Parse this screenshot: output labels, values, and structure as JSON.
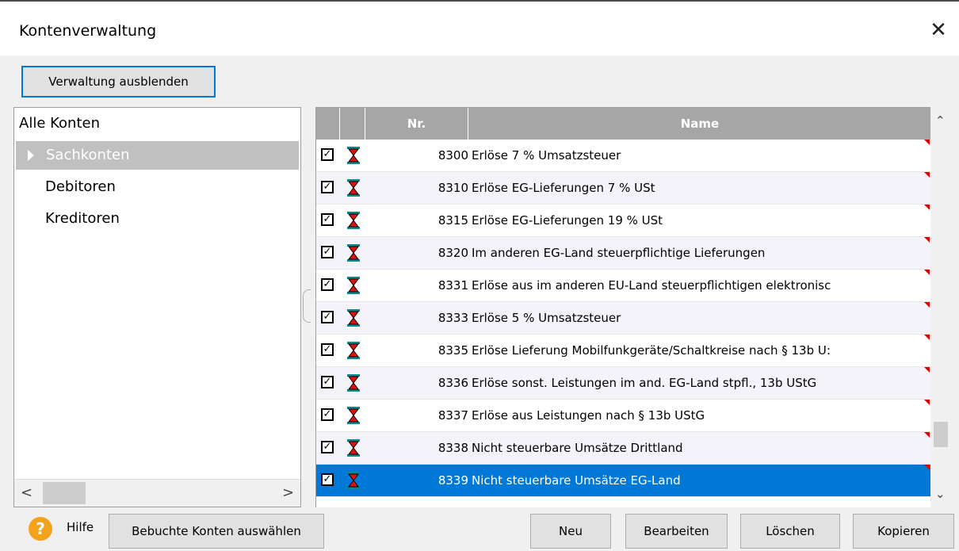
{
  "window": {
    "title": "Kontenverwaltung"
  },
  "toolbar": {
    "toggle_label": "Verwaltung ausblenden"
  },
  "tree": {
    "items": [
      {
        "label": "Alle Konten"
      },
      {
        "label": "Sachkonten"
      },
      {
        "label": "Debitoren"
      },
      {
        "label": "Kreditoren"
      }
    ],
    "selected": "Sachkonten"
  },
  "grid": {
    "headers": {
      "nr": "Nr.",
      "name": "Name"
    },
    "rows": [
      {
        "nr": "8300",
        "name": "Erlöse 7 % Umsatzsteuer",
        "checked": true
      },
      {
        "nr": "8310",
        "name": "Erlöse EG-Lieferungen 7 % USt",
        "checked": true
      },
      {
        "nr": "8315",
        "name": "Erlöse EG-Lieferungen 19 % USt",
        "checked": true
      },
      {
        "nr": "8320",
        "name": "Im anderen EG-Land steuerpflichtige Lieferungen",
        "checked": true
      },
      {
        "nr": "8331",
        "name": "Erlöse aus im anderen EU-Land steuerpflichtigen elektronisc",
        "checked": true
      },
      {
        "nr": "8333",
        "name": "Erlöse 5 % Umsatzsteuer",
        "checked": true
      },
      {
        "nr": "8335",
        "name": "Erlöse Lieferung Mobilfunkgeräte/Schaltkreise nach § 13b U:",
        "checked": true
      },
      {
        "nr": "8336",
        "name": "Erlöse sonst. Leistungen im and. EG-Land stpfl., 13b UStG",
        "checked": true
      },
      {
        "nr": "8337",
        "name": "Erlöse aus Leistungen nach § 13b UStG",
        "checked": true
      },
      {
        "nr": "8338",
        "name": "Nicht steuerbare Umsätze Drittland",
        "checked": true
      },
      {
        "nr": "8339",
        "name": "Nicht steuerbare Umsätze EG-Land",
        "checked": true
      }
    ],
    "selected_nr": "8339"
  },
  "footer": {
    "help_label": "Hilfe",
    "select_booked_label": "Bebuchte Konten auswählen",
    "new_label": "Neu",
    "edit_label": "Bearbeiten",
    "delete_label": "Löschen",
    "copy_label": "Kopieren"
  },
  "colors": {
    "accent": "#0078d7",
    "header": "#a6a6a6",
    "help": "#f3a21b"
  }
}
